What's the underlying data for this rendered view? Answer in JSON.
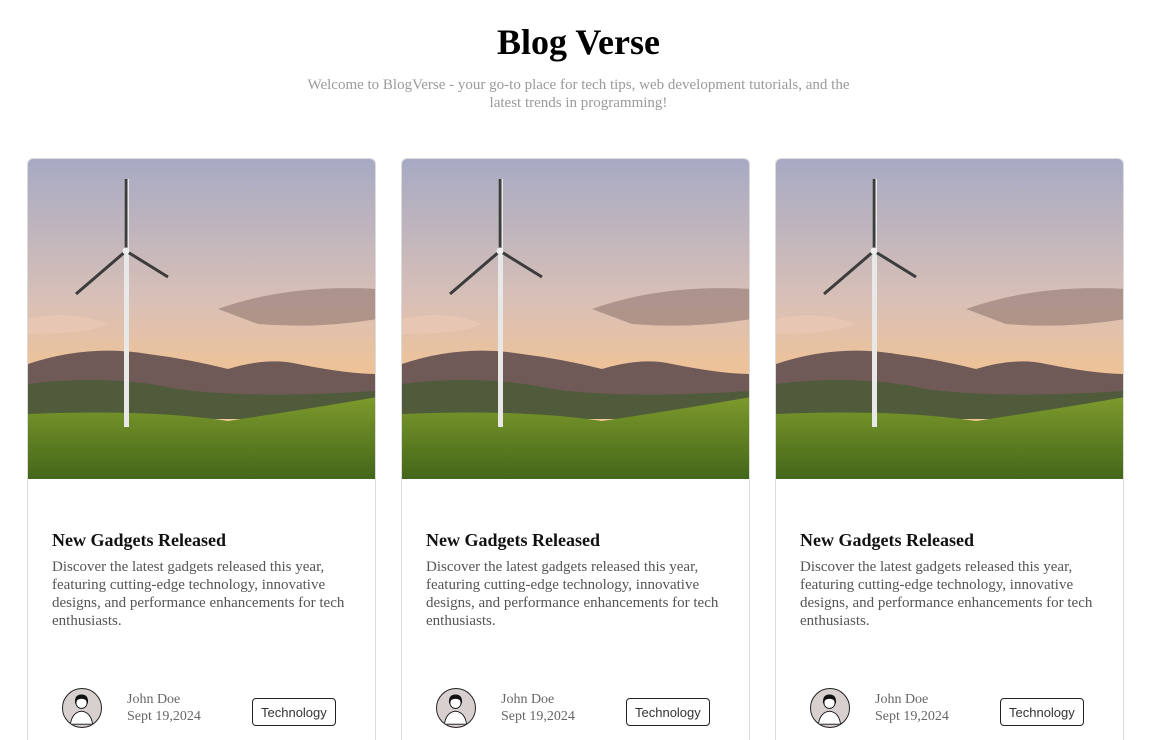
{
  "header": {
    "title": "Blog Verse",
    "subtitle": "Welcome to BlogVerse - your go-to place for tech tips, web development tutorials, and the latest trends in programming!"
  },
  "posts": [
    {
      "image": "wind-turbine-landscape",
      "title": "New Gadgets Released",
      "description": "Discover the latest gadgets released this year, featuring cutting-edge technology, innovative designs, and performance enhancements for tech enthusiasts.",
      "author": "John Doe",
      "date": "Sept 19,2024",
      "tag": "Technology",
      "avatar_icon": "user-avatar-icon"
    },
    {
      "image": "wind-turbine-landscape",
      "title": "New Gadgets Released",
      "description": "Discover the latest gadgets released this year, featuring cutting-edge technology, innovative designs, and performance enhancements for tech enthusiasts.",
      "author": "John Doe",
      "date": "Sept 19,2024",
      "tag": "Technology",
      "avatar_icon": "user-avatar-icon"
    },
    {
      "image": "wind-turbine-landscape",
      "title": "New Gadgets Released",
      "description": "Discover the latest gadgets released this year, featuring cutting-edge technology, innovative designs, and performance enhancements for tech enthusiasts.",
      "author": "John Doe",
      "date": "Sept 19,2024",
      "tag": "Technology",
      "avatar_icon": "user-avatar-icon"
    }
  ],
  "colors": {
    "subtitle": "#9a9a9a",
    "card_border": "#dcdcdc",
    "text_muted": "#555555"
  }
}
